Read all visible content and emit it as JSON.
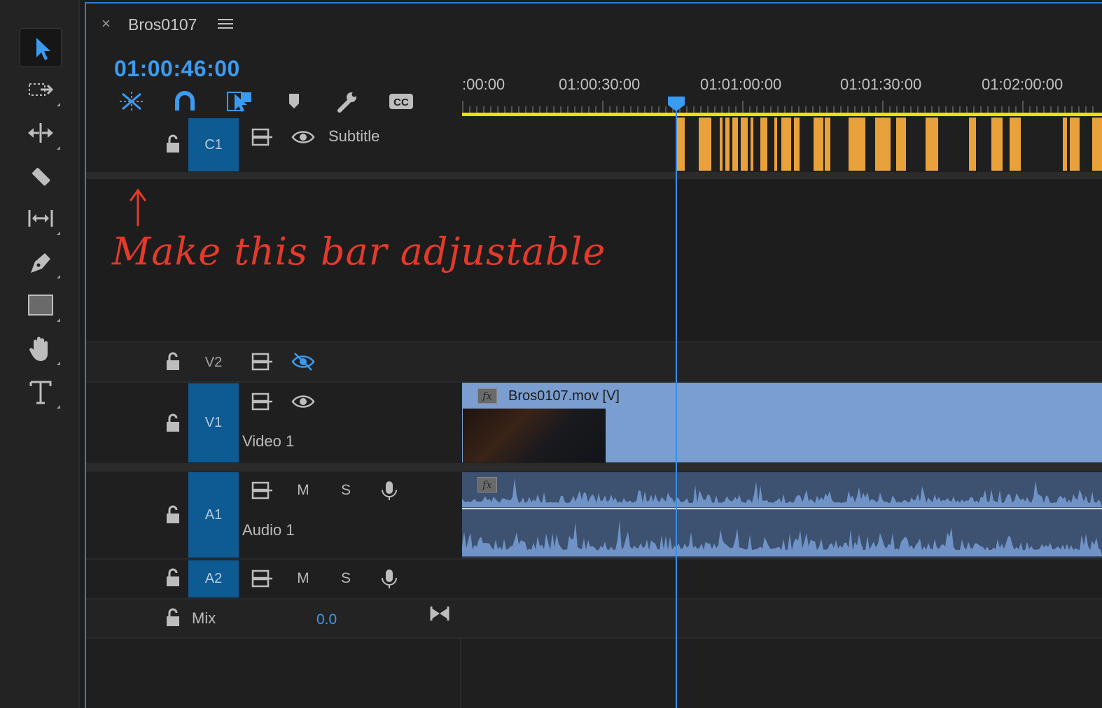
{
  "sequence": {
    "tab_name": "Bros0107",
    "timecode": "01:00:46:00"
  },
  "header_tools": [
    {
      "icon": "insert-sequence-nest-icon",
      "active": true
    },
    {
      "icon": "snap-magnet-icon",
      "active": true
    },
    {
      "icon": "linked-selection-icon",
      "active": true
    },
    {
      "icon": "add-marker-icon",
      "active": false
    },
    {
      "icon": "timeline-settings-wrench-icon",
      "active": false
    },
    {
      "icon": "captions-cc-icon",
      "active": false
    }
  ],
  "toolbar_tools": [
    {
      "icon": "selection-arrow-icon",
      "active": true
    },
    {
      "icon": "track-select-forward-icon",
      "active": false
    },
    {
      "icon": "ripple-edit-icon",
      "active": false
    },
    {
      "icon": "razor-icon",
      "active": false
    },
    {
      "icon": "slip-icon",
      "active": false
    },
    {
      "icon": "pen-icon",
      "active": false
    },
    {
      "icon": "rectangle-icon",
      "active": false
    },
    {
      "icon": "hand-icon",
      "active": false
    },
    {
      "icon": "type-icon",
      "active": false
    }
  ],
  "ruler": {
    "labels": [
      ":00:00",
      "01:00:30:00",
      "01:01:00:00",
      "01:01:30:00",
      "01:02:00:00"
    ]
  },
  "tracks": {
    "c1": {
      "target": "C1",
      "name": "Subtitle"
    },
    "v2": {
      "target": "V2"
    },
    "v1": {
      "target": "V1",
      "name": "Video 1"
    },
    "a1": {
      "target": "A1",
      "name": "Audio 1",
      "mute": "M",
      "solo": "S"
    },
    "a2": {
      "target": "A2",
      "mute": "M",
      "solo": "S"
    },
    "mix": {
      "name": "Mix",
      "value": "0.0"
    }
  },
  "clips": {
    "video": {
      "name": "Bros0107.mov [V]",
      "fx": "fx"
    },
    "audio": {
      "fx": "fx"
    }
  },
  "annotation": {
    "text": "Make this bar adjustable"
  },
  "colors": {
    "accent": "#3b9bf0",
    "subtitle_clip": "#e9a23b",
    "video_clip": "#7a9ecf",
    "audio_clip": "#3d5170",
    "work_area": "#f0e000",
    "annotation": "#e43a2a"
  }
}
